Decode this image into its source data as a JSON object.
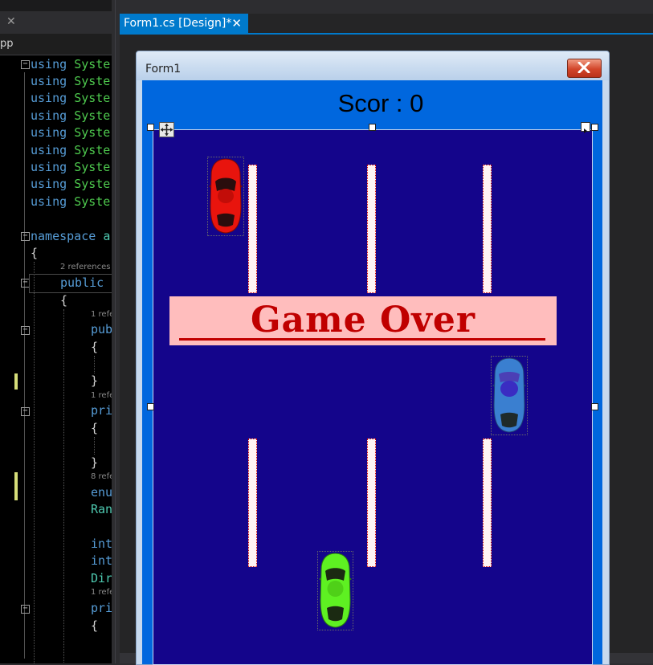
{
  "editor": {
    "tab_close": "✕",
    "tab_name": "pp",
    "code_lines": [
      {
        "k": "using",
        "n": "Syste"
      },
      {
        "k": "using",
        "n": "Syste"
      },
      {
        "k": "using",
        "n": "Syste"
      },
      {
        "k": "using",
        "n": "Syste"
      },
      {
        "k": "using",
        "n": "Syste"
      },
      {
        "k": "using",
        "n": "Syste"
      },
      {
        "k": "using",
        "n": "Syste"
      },
      {
        "k": "using",
        "n": "Syste"
      },
      {
        "k": "using",
        "n": "Syste"
      }
    ],
    "namespace_kw": "namespace",
    "namespace_name": "a",
    "open_brace": "{",
    "close_brace": "}",
    "ref2": "2 references",
    "public_kw": "public",
    "ref1a": "1 refe",
    "pub": "pub",
    "ref1b": "1 refe",
    "pri": "pri",
    "ref8": "8 refe",
    "enu": "enu",
    "ran": "Ran",
    "int1": "int",
    "int2": "int",
    "dir": "Dir",
    "ref1c": "1 refe",
    "pri2": "pri"
  },
  "designer": {
    "tab_title": "Form1.cs [Design]*",
    "tab_close": "✕"
  },
  "form": {
    "title": "Form1",
    "score_text": "Scor : 0",
    "game_over": "Game Over"
  },
  "colors": {
    "accent": "#007acc",
    "road": "#14058b",
    "client": "#0067de",
    "game_over_bg": "#ffbdbd",
    "game_over_text": "#c00000",
    "car_red": "#e8140d",
    "car_blue": "#3a7fd0",
    "car_green": "#5ef022"
  }
}
